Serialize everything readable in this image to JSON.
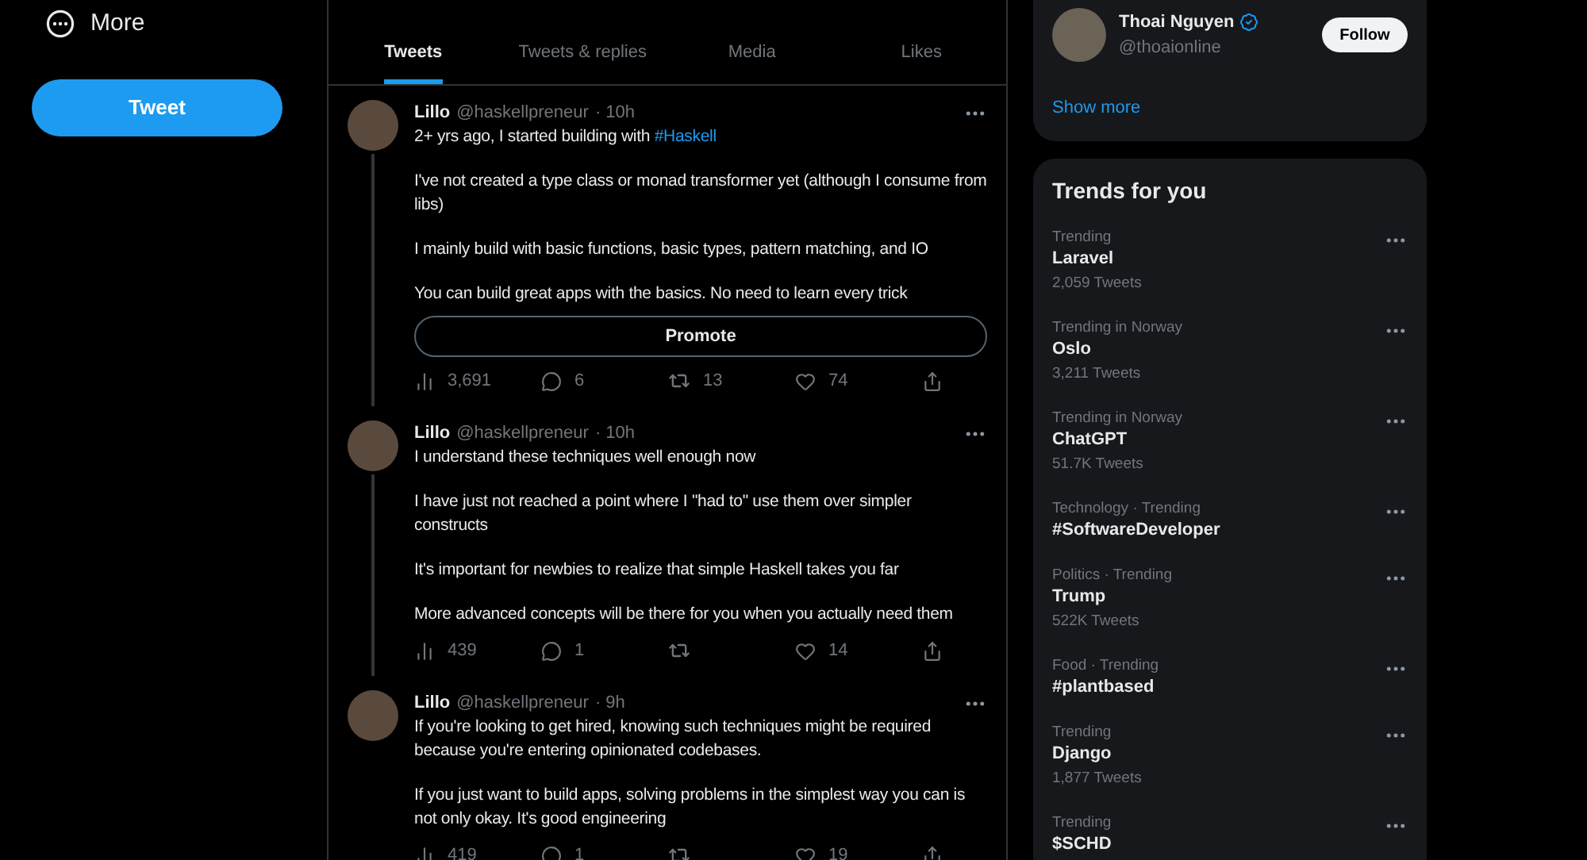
{
  "nav": {
    "more_label": "More",
    "tweet_button": "Tweet"
  },
  "tabs": [
    {
      "label": "Tweets",
      "selected": true
    },
    {
      "label": "Tweets & replies",
      "selected": false
    },
    {
      "label": "Media",
      "selected": false
    },
    {
      "label": "Likes",
      "selected": false
    }
  ],
  "tweets": [
    {
      "name": "Lillo",
      "handle": "@haskellpreneur",
      "time": "· 10h",
      "thread_continues": true,
      "paragraphs": [
        {
          "text": "2+ yrs ago, I started building with",
          "link": "#Haskell"
        },
        {
          "text": "I've not created a type class or monad transformer yet (although I consume from libs)"
        },
        {
          "text": "I mainly build with basic functions, basic types, pattern matching, and IO"
        },
        {
          "text": "You can build great apps with the basics. No need to learn every trick"
        }
      ],
      "promote": "Promote",
      "views": "3,691",
      "replies": "6",
      "retweets": "13",
      "likes": "74"
    },
    {
      "name": "Lillo",
      "handle": "@haskellpreneur",
      "time": "· 10h",
      "thread_continues": true,
      "paragraphs": [
        {
          "text": "I understand these techniques well enough now"
        },
        {
          "text": "I have just not reached a point where I \"had to\" use them over simpler constructs"
        },
        {
          "text": "It's important for newbies to realize that simple Haskell takes you far"
        },
        {
          "text": "More advanced concepts will be there for you when you actually need them"
        }
      ],
      "views": "439",
      "replies": "1",
      "likes": "14"
    },
    {
      "name": "Lillo",
      "handle": "@haskellpreneur",
      "time": "· 9h",
      "thread_continues": false,
      "paragraphs": [
        {
          "text": "If you're looking to get hired, knowing such techniques might be required because you're entering opinionated codebases."
        },
        {
          "text": "If you just want to build apps, solving problems in the simplest way you can is not only okay. It's good engineering"
        }
      ],
      "views": "419",
      "replies": "1",
      "likes": "19"
    }
  ],
  "who_to_follow": {
    "name": "Thoai Nguyen",
    "verified": true,
    "handle": "@thoaionline",
    "follow_button": "Follow",
    "show_more": "Show more"
  },
  "trends": {
    "title": "Trends for you",
    "items": [
      {
        "context": "Trending",
        "topic": "Laravel",
        "count": "2,059 Tweets"
      },
      {
        "context": "Trending in Norway",
        "topic": "Oslo",
        "count": "3,211 Tweets"
      },
      {
        "context": "Trending in Norway",
        "topic": "ChatGPT",
        "count": "51.7K Tweets"
      },
      {
        "context": "Technology · Trending",
        "topic": "#SoftwareDeveloper"
      },
      {
        "context": "Politics · Trending",
        "topic": "Trump",
        "count": "522K Tweets"
      },
      {
        "context": "Food · Trending",
        "topic": "#plantbased"
      },
      {
        "context": "Trending",
        "topic": "Django",
        "count": "1,877 Tweets"
      },
      {
        "context": "Trending",
        "topic": "$SCHD"
      }
    ]
  }
}
